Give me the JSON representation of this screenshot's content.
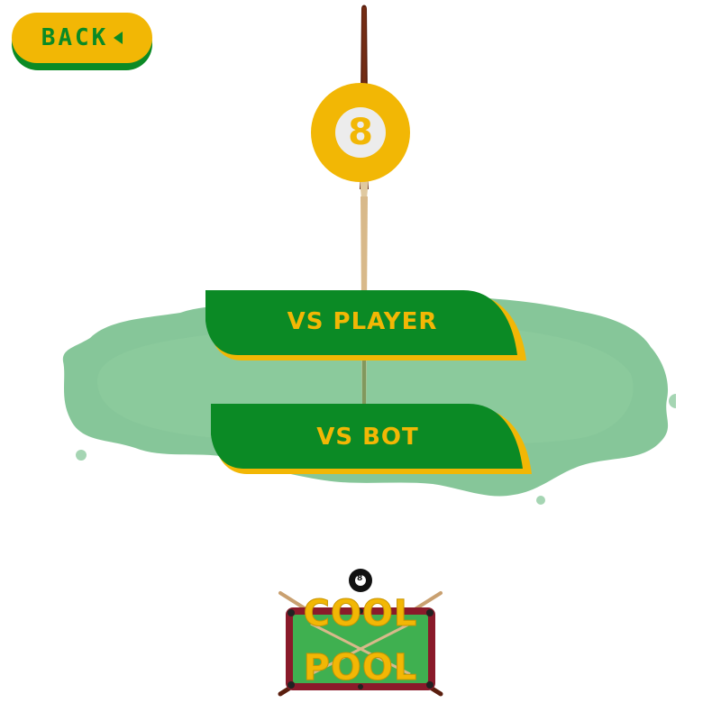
{
  "header": {
    "back_label": "BACK"
  },
  "badge": {
    "number": "8"
  },
  "menu": {
    "vs_player_label": "VS PLAYER",
    "vs_bot_label": "VS BOT"
  },
  "logo": {
    "line1": "COOL",
    "line2": "POOL",
    "ball_number": "8"
  },
  "colors": {
    "accent_yellow": "#f2b705",
    "brand_green": "#0b8a25",
    "splash_green": "#7fc393",
    "cue_brown": "#5a1e0e",
    "cue_tan": "#d8b98a"
  },
  "icons": {
    "back_arrow": "triangle-left-icon"
  }
}
